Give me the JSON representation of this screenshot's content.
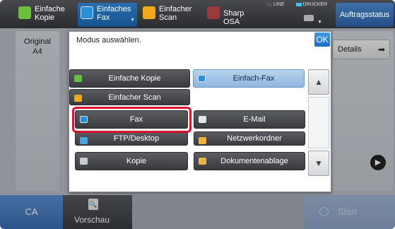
{
  "topbar": {
    "tabs": [
      {
        "line1": "Einfache",
        "line2": "Kopie",
        "icon": "copy-icon"
      },
      {
        "line1": "Einfaches",
        "line2": "Fax",
        "icon": "fax-icon"
      },
      {
        "line1": "Einfacher",
        "line2": "Scan",
        "icon": "scan-icon"
      },
      {
        "line1": "Sharp OSA",
        "line2": "",
        "icon": "osa-icon"
      }
    ],
    "led_line": "LINE",
    "led_drucker": "DRUCKER",
    "job_status": "Auftragsstatus"
  },
  "original": {
    "label": "Original",
    "size": "A4"
  },
  "right_panel": {
    "details": "Details"
  },
  "bottom": {
    "ca": "CA",
    "preview": "Vorschau",
    "start": "Start"
  },
  "dialog": {
    "title": "Modus auswählen.",
    "ok": "OK",
    "buttons": {
      "einfache_kopie": "Einfache Kopie",
      "einfach_fax": "Einfach-Fax",
      "einfacher_scan": "Einfacher Scan",
      "fax": "Fax",
      "email": "E-Mail",
      "ftp": "FTP/Desktop",
      "netzwerkordner": "Netzwerkordner",
      "kopie": "Kopie",
      "dokumentenablage": "Dokumentenablage"
    }
  },
  "colors": {
    "accent_blue": "#1c6fc2",
    "highlight_red": "#d9132b",
    "selected": "#b6d3ee"
  }
}
